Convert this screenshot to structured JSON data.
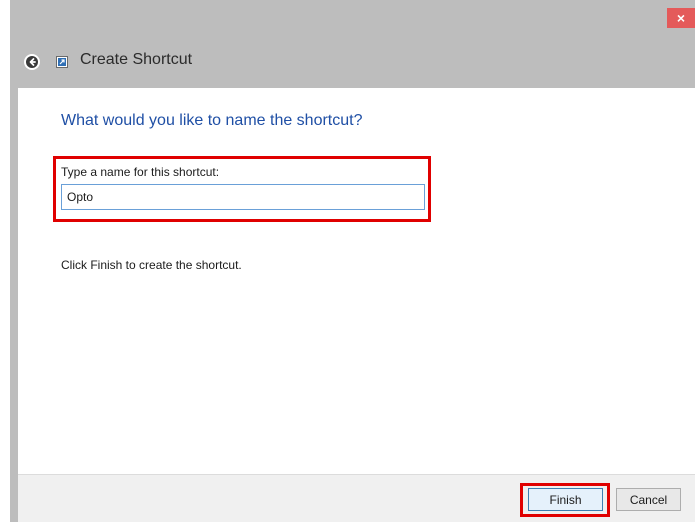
{
  "window": {
    "title": "Create Shortcut",
    "close_glyph": "×"
  },
  "icons": {
    "back": "back-arrow-icon",
    "app": "shortcut-icon",
    "close": "close-icon"
  },
  "main": {
    "heading": "What would you like to name the shortcut?",
    "name_label": "Type a name for this shortcut:",
    "name_value": "Opto",
    "hint": "Click Finish to create the shortcut."
  },
  "footer": {
    "finish_label": "Finish",
    "cancel_label": "Cancel"
  },
  "colors": {
    "accent_heading": "#1f4fa5",
    "highlight": "#e00000",
    "close_button": "#e45a5a"
  }
}
